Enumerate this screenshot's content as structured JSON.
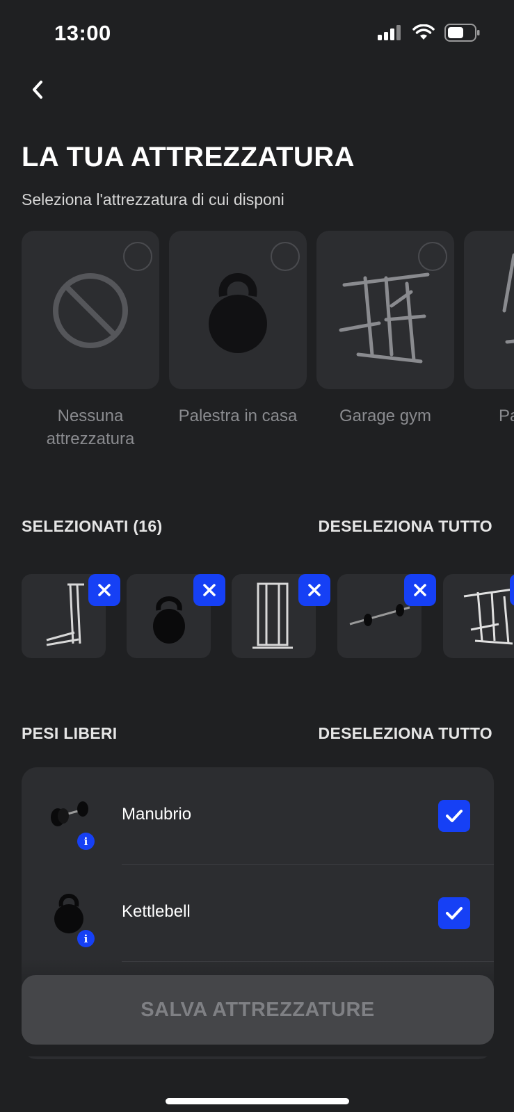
{
  "status_bar": {
    "time": "13:00"
  },
  "header": {
    "title": "LA TUA ATTREZZATURA",
    "subtitle": "Seleziona l'attrezzatura di cui disponi"
  },
  "presets": [
    {
      "label": "Nessuna attrezzatura",
      "icon": "no-equipment-icon"
    },
    {
      "label": "Palestra in casa",
      "icon": "kettlebell-icon"
    },
    {
      "label": "Garage gym",
      "icon": "power-rack-icon"
    },
    {
      "label": "Pa… d…",
      "icon": "cable-machine-icon"
    }
  ],
  "selected": {
    "title": "SELEZIONATI (16)",
    "deselect_label": "DESELEZIONA TUTTO",
    "items": [
      "lat-pulldown",
      "kettlebell",
      "cable-tower",
      "barbell",
      "power-rack"
    ]
  },
  "free_weights": {
    "title": "PESI LIBERI",
    "deselect_label": "DESELEZIONA TUTTO",
    "items": [
      {
        "label": "Manubrio",
        "checked": true,
        "icon": "dumbbell-icon"
      },
      {
        "label": "Kettlebell",
        "checked": true,
        "icon": "kettlebell-icon"
      }
    ]
  },
  "save_button": {
    "label": "SALVA ATTREZZATURE"
  },
  "colors": {
    "accent": "#1640f5",
    "background": "#1f2022",
    "card": "#2c2d30"
  }
}
